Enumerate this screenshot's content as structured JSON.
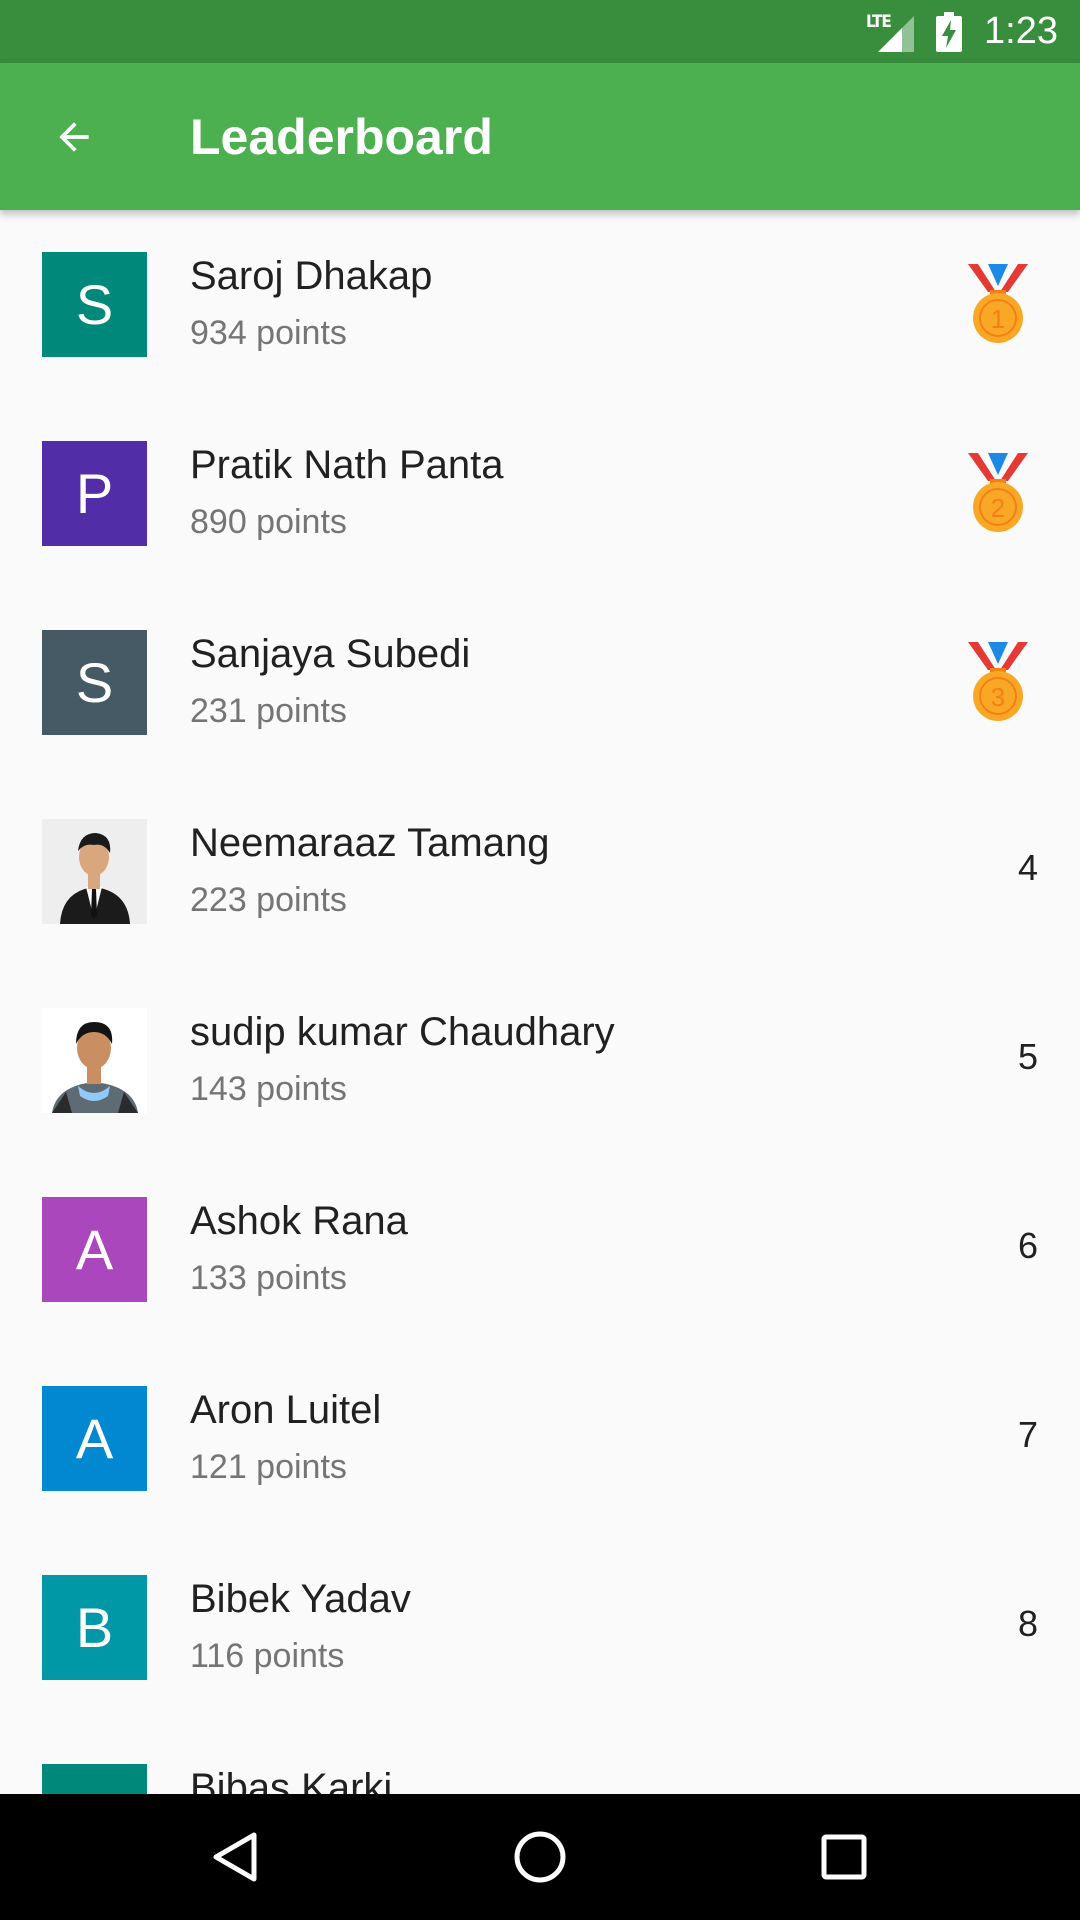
{
  "status_bar": {
    "network": "LTE",
    "time": "1:23",
    "icons": [
      "lte-signal-icon",
      "battery-charging-icon"
    ]
  },
  "app_bar": {
    "back_icon": "arrow-back-icon",
    "title": "Leaderboard"
  },
  "leaderboard": [
    {
      "initial": "S",
      "avatar_color": "#00897b",
      "name": "Saroj Dhakap",
      "points": "934 points",
      "rank": "1",
      "medal": true
    },
    {
      "initial": "P",
      "avatar_color": "#512da8",
      "name": "Pratik Nath Panta",
      "points": "890 points",
      "rank": "2",
      "medal": true
    },
    {
      "initial": "S",
      "avatar_color": "#455a64",
      "name": "Sanjaya Subedi",
      "points": "231 points",
      "rank": "3",
      "medal": true
    },
    {
      "initial": "",
      "avatar_color": "",
      "avatar_type": "photo",
      "name": "Neemaraaz Tamang",
      "points": "223 points",
      "rank": "4",
      "medal": false
    },
    {
      "initial": "",
      "avatar_color": "",
      "avatar_type": "photo",
      "name": "sudip kumar  Chaudhary",
      "points": "143 points",
      "rank": "5",
      "medal": false
    },
    {
      "initial": "A",
      "avatar_color": "#ab47bc",
      "name": "Ashok Rana",
      "points": "133 points",
      "rank": "6",
      "medal": false
    },
    {
      "initial": "A",
      "avatar_color": "#0288d1",
      "name": "Aron Luitel",
      "points": "121 points",
      "rank": "7",
      "medal": false
    },
    {
      "initial": "B",
      "avatar_color": "#0097a7",
      "name": "Bibek Yadav",
      "points": "116 points",
      "rank": "8",
      "medal": false
    },
    {
      "initial": "",
      "avatar_color": "#00897b",
      "name": "Bibas Karki",
      "points": "",
      "rank": "",
      "medal": false
    }
  ],
  "colors": {
    "app_bar": "#4caf50",
    "status_bar": "#388e3c",
    "medal_gold": "#f9a825",
    "ribbon_red": "#e53935",
    "ribbon_blue": "#1e88e5"
  },
  "nav_bar": {
    "back": "nav-back-icon",
    "home": "nav-home-icon",
    "recents": "nav-recents-icon"
  }
}
